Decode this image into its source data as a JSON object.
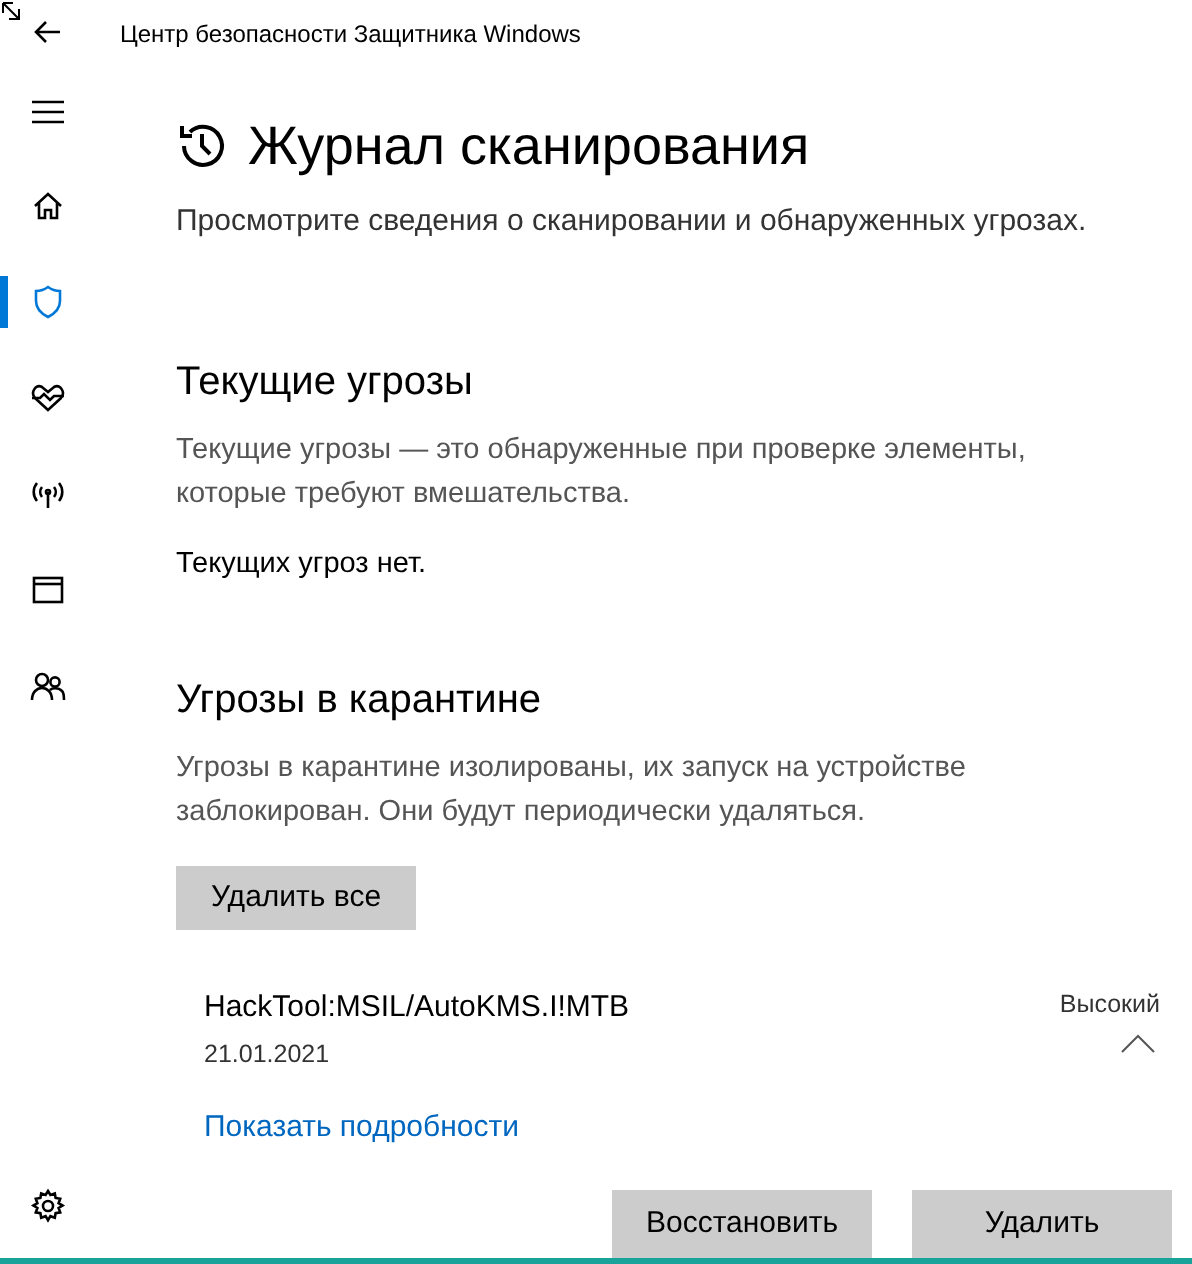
{
  "window": {
    "title": "Центр безопасности Защитника Windows"
  },
  "sidebar": {
    "items": [
      {
        "kind": "home",
        "selected": false
      },
      {
        "kind": "shield",
        "selected": true
      },
      {
        "kind": "health",
        "selected": false
      },
      {
        "kind": "network",
        "selected": false
      },
      {
        "kind": "browser",
        "selected": false
      },
      {
        "kind": "family",
        "selected": false
      }
    ]
  },
  "page": {
    "title": "Журнал сканирования",
    "subtitle": "Просмотрите сведения о сканировании и обнаруженных угрозах."
  },
  "current_threats": {
    "heading": "Текущие угрозы",
    "description": "Текущие угрозы — это обнаруженные при проверке элементы, которые требуют вмешательства.",
    "status": "Текущих угроз нет."
  },
  "quarantine": {
    "heading": "Угрозы в карантине",
    "description": "Угрозы в карантине изолированы, их запуск на устройстве заблокирован. Они будут периодически удаляться.",
    "remove_all": "Удалить все",
    "items": [
      {
        "name": "HackTool:MSIL/AutoKMS.I!MTB",
        "date": "21.01.2021",
        "severity": "Высокий",
        "expanded": true,
        "details_link": "Показать подробности",
        "actions": [
          "Восстановить",
          "Удалить"
        ]
      }
    ]
  }
}
